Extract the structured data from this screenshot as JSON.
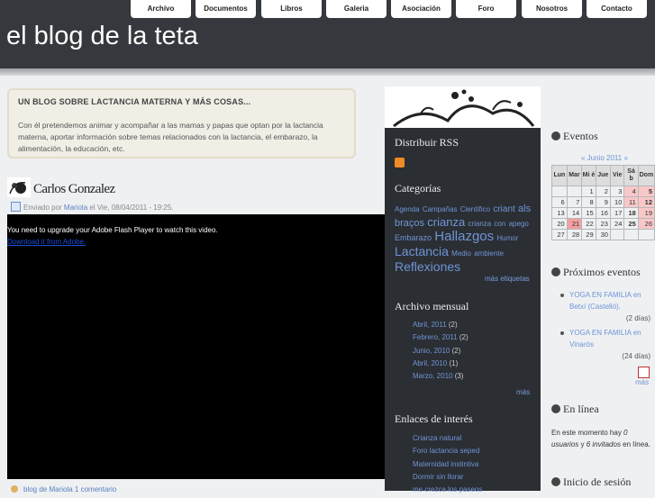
{
  "site": {
    "title": "el blog de la teta"
  },
  "nav": {
    "items": [
      "Archivo",
      "Documentos",
      "Libros",
      "Galeria",
      "Asociación",
      "Foro",
      "Nosotros",
      "Contacto"
    ]
  },
  "intro": {
    "title": "UN BLOG SOBRE LACTANCIA MATERNA Y MÁS COSAS...",
    "text": "Con él pretendemos animar y acompañar a las mamas y papas que optan por la lactancia materna, aportar información sobre temas relacionados con la lactancia, el embarazo, la alimentación, la educación, etc."
  },
  "post": {
    "title": "Carlos Gonzalez",
    "meta_prefix": "Enviado por ",
    "author": "Mariola",
    "meta_suffix": " el Vie, 08/04/2011 - 19:25.",
    "flash_message": "You need to upgrade your Adobe Flash Player to watch this video.",
    "flash_link": "Download it from Adobe.",
    "footer": "blog de Mariola   1 comentario"
  },
  "mid": {
    "rss_heading": "Distribuir RSS",
    "categories_heading": "Categorías",
    "tags": [
      {
        "label": "Agenda",
        "size": 8
      },
      {
        "label": "Campañas",
        "size": 8
      },
      {
        "label": "Científico",
        "size": 8
      },
      {
        "label": "criant",
        "size": 10
      },
      {
        "label": "als braços",
        "size": 11
      },
      {
        "label": "crianza",
        "size": 13
      },
      {
        "label": "crianza con",
        "size": 8
      },
      {
        "label": "apego",
        "size": 8
      },
      {
        "label": "Embarazo",
        "size": 9
      },
      {
        "label": "Hallazgos",
        "size": 15
      },
      {
        "label": "Humor",
        "size": 8
      },
      {
        "label": "Lactancia",
        "size": 14
      },
      {
        "label": "Medio",
        "size": 8
      },
      {
        "label": "ambiente",
        "size": 8
      },
      {
        "label": "Reflexiones",
        "size": 14
      }
    ],
    "more_tags": "más etiquetas",
    "archive_heading": "Archivo mensual",
    "archive": [
      {
        "label": "Abril, 2011",
        "count": " (2)"
      },
      {
        "label": "Febrero, 2011",
        "count": " (2)"
      },
      {
        "label": "Junio, 2010",
        "count": " (2)"
      },
      {
        "label": "Abril, 2010",
        "count": " (1)"
      },
      {
        "label": "Marzo, 2010",
        "count": " (3)"
      }
    ],
    "archive_more": "más",
    "links_heading": "Enlaces de interés",
    "links": [
      "Crianza natural",
      "Foro lactancia seped",
      "Maternidad instintiva",
      "Dormir sin llorar",
      "me crezca los paseos"
    ]
  },
  "right": {
    "events_heading": "Eventos",
    "calendar_caption": "« Junio 2011 »",
    "calendar_headers": [
      "Lun",
      "Mar",
      "Mi é",
      "Jue",
      "Vie",
      "Sá b",
      "Dom"
    ],
    "calendar_rows": [
      [
        "",
        "",
        "1",
        "2",
        "3",
        "4",
        "5"
      ],
      [
        "6",
        "7",
        "8",
        "9",
        "10",
        "11",
        "12"
      ],
      [
        "13",
        "14",
        "15",
        "16",
        "17",
        "18",
        "19"
      ],
      [
        "20",
        "21",
        "22",
        "23",
        "24",
        "25",
        "26"
      ],
      [
        "27",
        "28",
        "29",
        "30",
        "",
        "",
        ""
      ]
    ],
    "upcoming_heading": "Próximos eventos",
    "events": [
      {
        "name": "YOGA EN FAMILIA en Betxí (Castelló).",
        "days": "(2 días)"
      },
      {
        "name": "YOGA EN FAMILIA en Vinaròs",
        "days": "(24 días)"
      }
    ],
    "more_events": "más",
    "online_heading": "En línea",
    "online_text_a": "En este momento hay ",
    "online_users": "0 usuarios",
    "online_text_b": " y ",
    "online_guests": "6 invitados",
    "online_text_c": " en línea.",
    "login_heading": "Inicio de sesión"
  }
}
